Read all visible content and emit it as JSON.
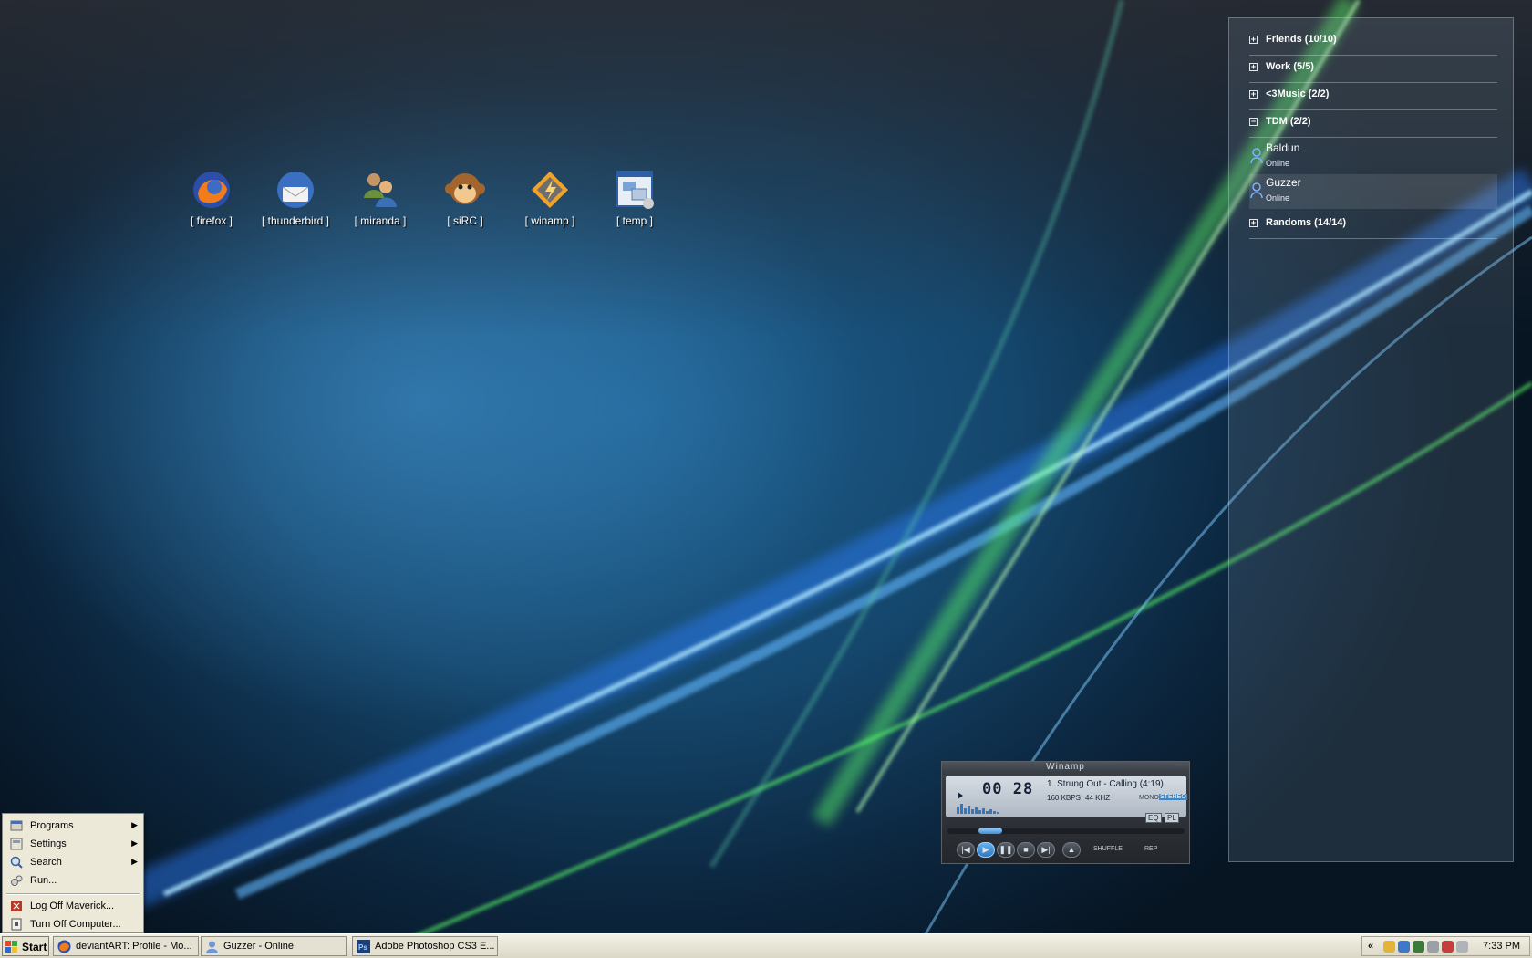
{
  "desktop": {
    "icons": [
      {
        "label": "[ firefox ]",
        "icon": "firefox-icon"
      },
      {
        "label": "[ thunderbird ]",
        "icon": "thunderbird-icon"
      },
      {
        "label": "[ miranda ]",
        "icon": "miranda-icon"
      },
      {
        "label": "[ siRC ]",
        "icon": "monkey-icon"
      },
      {
        "label": "[ winamp ]",
        "icon": "winamp-icon"
      },
      {
        "label": "[ temp ]",
        "icon": "folder-window-icon"
      }
    ]
  },
  "buddy_list": {
    "groups": [
      {
        "name": "Friends (10/10)",
        "expanded": false
      },
      {
        "name": "Work (5/5)",
        "expanded": false
      },
      {
        "name": "<3Music (2/2)",
        "expanded": false
      },
      {
        "name": "TDM (2/2)",
        "expanded": true
      },
      {
        "name": "Randoms (14/14)",
        "expanded": false
      }
    ],
    "contacts": [
      {
        "name": "Baldun",
        "status": "Online"
      },
      {
        "name": "Guzzer",
        "status": "Online",
        "selected": true
      }
    ],
    "expand_glyph": "+",
    "collapse_glyph": "−"
  },
  "winamp": {
    "title": "Winamp",
    "time": "00 28",
    "track": "1. Strung Out - Calling (4:19)",
    "kbps": "160 KBPS",
    "khz": "44 KHZ",
    "mono": "MONO",
    "stereo": "STEREO",
    "eq": "EQ",
    "pl": "PL",
    "shuffle": "SHUFFLE",
    "rep": "REP",
    "buttons": {
      "prev": "|◀",
      "play": "▶",
      "pause": "❚❚",
      "stop": "■",
      "next": "▶|",
      "eject": "▲"
    }
  },
  "start_menu": {
    "items": [
      {
        "label": "Programs",
        "icon": "programs-icon",
        "submenu": true
      },
      {
        "label": "Settings",
        "icon": "settings-icon",
        "submenu": true
      },
      {
        "label": "Search",
        "icon": "search-icon",
        "submenu": true
      },
      {
        "label": "Run...",
        "icon": "run-icon",
        "submenu": false
      }
    ],
    "session_items": [
      {
        "label": "Log Off Maverick...",
        "icon": "log-off-icon"
      },
      {
        "label": "Turn Off Computer...",
        "icon": "power-icon"
      }
    ],
    "submenu_arrow": "▶"
  },
  "taskbar": {
    "start_label": "Start",
    "tasks": [
      {
        "label": "deviantART: Profile - Mo...",
        "icon": "firefox-icon"
      },
      {
        "label": "Guzzer - Online",
        "icon": "user-icon"
      },
      {
        "label": "Adobe Photoshop CS3 E...",
        "icon": "photoshop-icon"
      }
    ],
    "tray_chevron": "«",
    "clock": "7:33 PM"
  },
  "colors": {
    "accent_blue": "#3c86c8",
    "taskbar_bg": "#dcd8c6",
    "wallpaper_green": "#5dff6a"
  }
}
